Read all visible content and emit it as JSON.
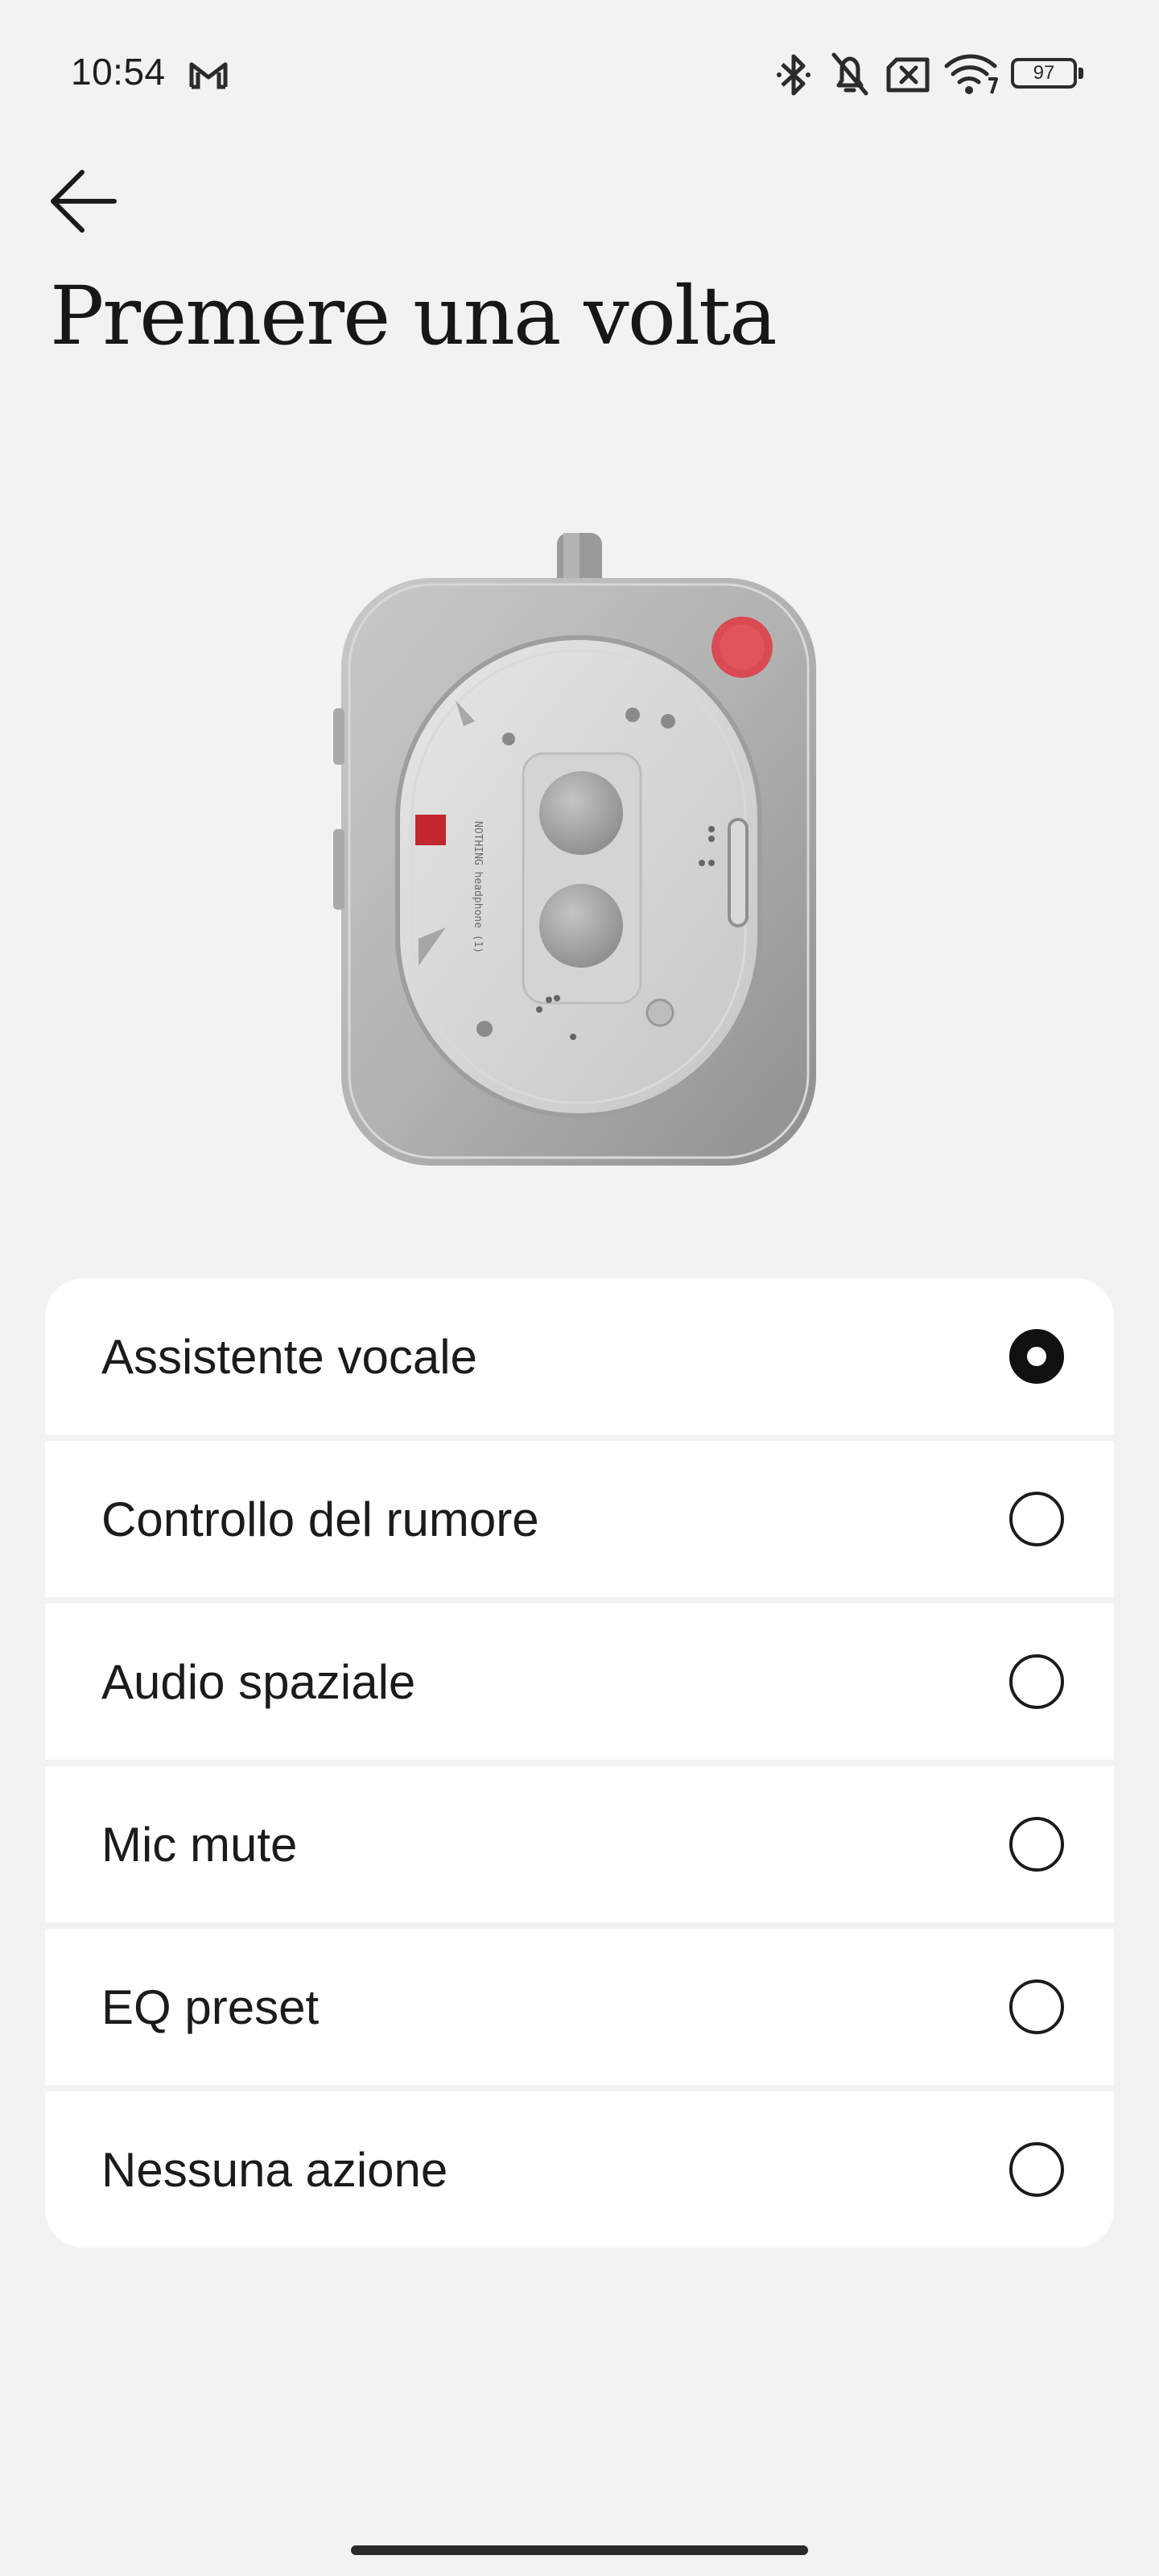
{
  "status_bar": {
    "time": "10:54",
    "notification_icon": "gmail-icon",
    "icons": [
      "bluetooth-icon",
      "bell-muted-icon",
      "no-sim-icon",
      "wifi-7-icon"
    ],
    "battery_level": "97"
  },
  "header": {
    "back_icon": "arrow-left-icon",
    "title": "Premere una volta"
  },
  "device_image": {
    "icon": "headphone-ear-cup-illustration",
    "engraving": "NOTHING  headphone (1)",
    "accent_color": "#e2545c"
  },
  "options": [
    {
      "label": "Assistente vocale",
      "selected": true
    },
    {
      "label": "Controllo del rumore",
      "selected": false
    },
    {
      "label": "Audio spaziale",
      "selected": false
    },
    {
      "label": "Mic mute",
      "selected": false
    },
    {
      "label": "EQ preset",
      "selected": false
    },
    {
      "label": "Nessuna azione",
      "selected": false
    }
  ],
  "colors": {
    "background": "#f2f2f2",
    "card": "#ffffff",
    "text": "#1b1b1b"
  }
}
